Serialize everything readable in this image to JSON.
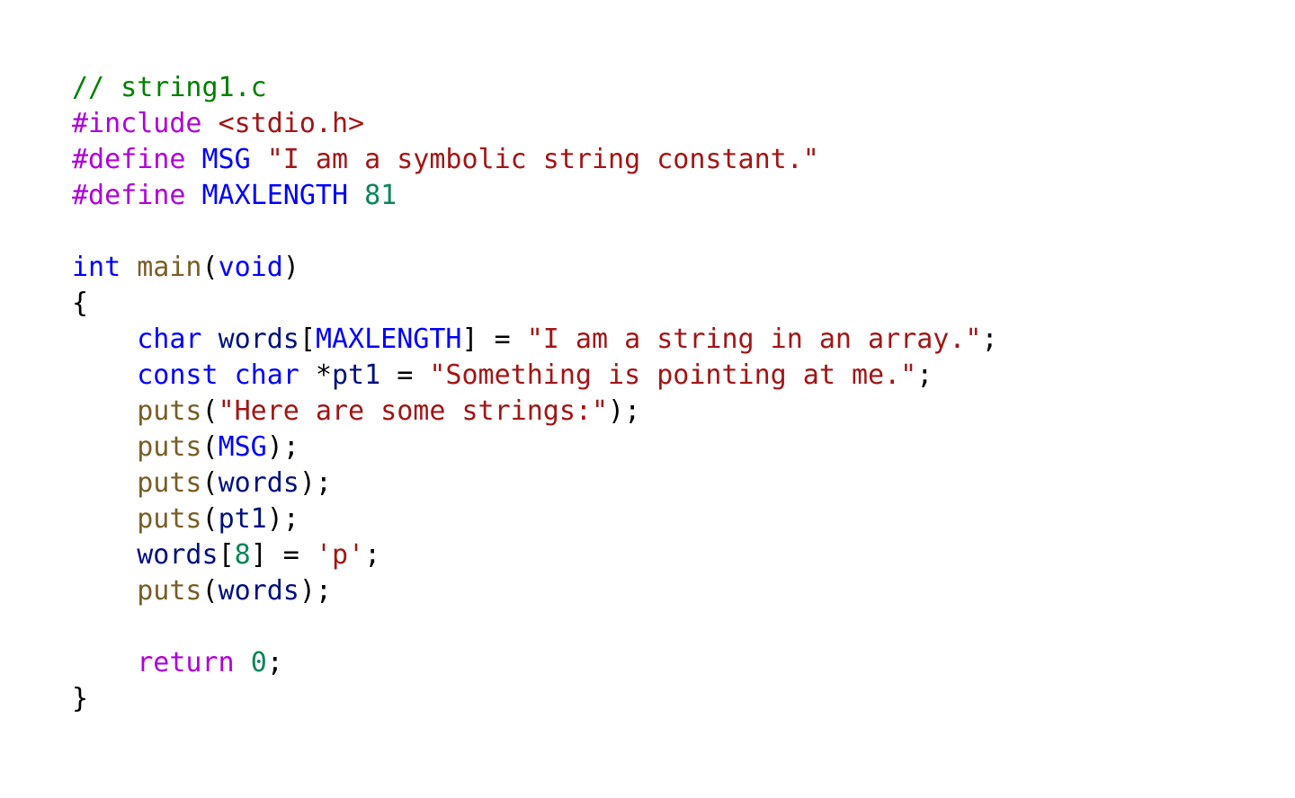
{
  "editor": {
    "lines": [
      [
        [
          "comment",
          "// string1.c"
        ]
      ],
      [
        [
          "preproc",
          "#include"
        ],
        [
          "punct",
          " "
        ],
        [
          "header",
          "<stdio.h>"
        ]
      ],
      [
        [
          "preproc",
          "#define"
        ],
        [
          "punct",
          " "
        ],
        [
          "macro",
          "MSG"
        ],
        [
          "punct",
          " "
        ],
        [
          "string",
          "\"I am a symbolic string constant.\""
        ]
      ],
      [
        [
          "preproc",
          "#define"
        ],
        [
          "punct",
          " "
        ],
        [
          "macro",
          "MAXLENGTH"
        ],
        [
          "punct",
          " "
        ],
        [
          "number",
          "81"
        ]
      ],
      [],
      [
        [
          "keyword",
          "int"
        ],
        [
          "punct",
          " "
        ],
        [
          "func",
          "main"
        ],
        [
          "punct",
          "("
        ],
        [
          "keyword",
          "void"
        ],
        [
          "punct",
          ")"
        ]
      ],
      [
        [
          "punct",
          "{"
        ]
      ],
      [
        [
          "punct",
          "    "
        ],
        [
          "keyword",
          "char"
        ],
        [
          "punct",
          " "
        ],
        [
          "var",
          "words"
        ],
        [
          "punct",
          "["
        ],
        [
          "macro",
          "MAXLENGTH"
        ],
        [
          "punct",
          "] = "
        ],
        [
          "string",
          "\"I am a string in an array.\""
        ],
        [
          "punct",
          ";"
        ]
      ],
      [
        [
          "punct",
          "    "
        ],
        [
          "keyword",
          "const"
        ],
        [
          "punct",
          " "
        ],
        [
          "keyword",
          "char"
        ],
        [
          "punct",
          " *"
        ],
        [
          "var",
          "pt1"
        ],
        [
          "punct",
          " = "
        ],
        [
          "string",
          "\"Something is pointing at me.\""
        ],
        [
          "punct",
          ";"
        ]
      ],
      [
        [
          "punct",
          "    "
        ],
        [
          "func",
          "puts"
        ],
        [
          "punct",
          "("
        ],
        [
          "string",
          "\"Here are some strings:\""
        ],
        [
          "punct",
          ");"
        ]
      ],
      [
        [
          "punct",
          "    "
        ],
        [
          "func",
          "puts"
        ],
        [
          "punct",
          "("
        ],
        [
          "macro",
          "MSG"
        ],
        [
          "punct",
          ");"
        ]
      ],
      [
        [
          "punct",
          "    "
        ],
        [
          "func",
          "puts"
        ],
        [
          "punct",
          "("
        ],
        [
          "var",
          "words"
        ],
        [
          "punct",
          ");"
        ]
      ],
      [
        [
          "punct",
          "    "
        ],
        [
          "func",
          "puts"
        ],
        [
          "punct",
          "("
        ],
        [
          "var",
          "pt1"
        ],
        [
          "punct",
          ");"
        ]
      ],
      [
        [
          "punct",
          "    "
        ],
        [
          "var",
          "words"
        ],
        [
          "punct",
          "["
        ],
        [
          "number",
          "8"
        ],
        [
          "punct",
          "] = "
        ],
        [
          "string",
          "'p'"
        ],
        [
          "punct",
          ";"
        ]
      ],
      [
        [
          "punct",
          "    "
        ],
        [
          "func",
          "puts"
        ],
        [
          "punct",
          "("
        ],
        [
          "var",
          "words"
        ],
        [
          "punct",
          ");"
        ]
      ],
      [],
      [
        [
          "punct",
          "    "
        ],
        [
          "control",
          "return"
        ],
        [
          "punct",
          " "
        ],
        [
          "number",
          "0"
        ],
        [
          "punct",
          ";"
        ]
      ],
      [
        [
          "punct",
          "}"
        ]
      ]
    ]
  }
}
